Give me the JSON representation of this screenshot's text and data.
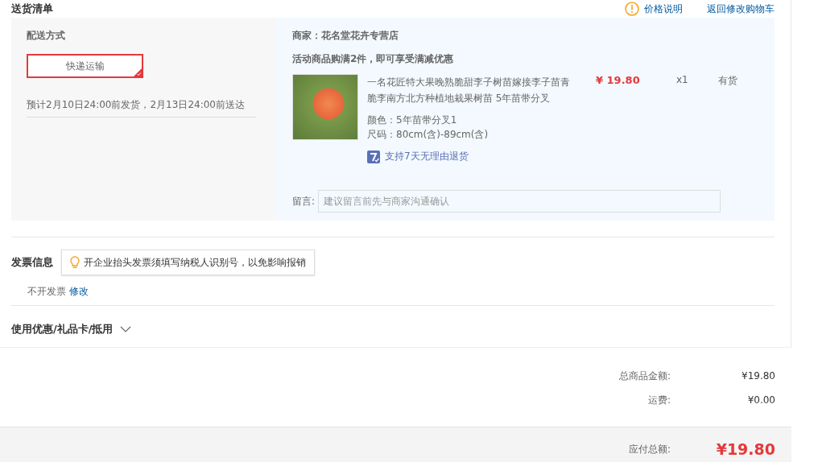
{
  "header": {
    "title": "送货清单",
    "links": [
      {
        "kind": "info",
        "label": "价格说明"
      },
      {
        "kind": "plain",
        "label": "返回修改购物车"
      }
    ]
  },
  "shipping": {
    "heading": "配送方式",
    "options": [
      {
        "label": "快递运输",
        "selected": true
      }
    ],
    "estimate": "预计2月10日24:00前发货，2月13日24:00前送达"
  },
  "merchant": {
    "name": "商家：花名堂花卉专营店",
    "promo": "活动商品购满2件，即可享受满减优惠",
    "item": {
      "title": "一名花匠特大果晚熟脆甜李子树苗嫁接李子苗青脆李南方北方种植地栽果树苗 5年苗带分叉",
      "price": "¥ 19.80",
      "qty": "x1",
      "stock": "有货",
      "attrs": [
        "颜色：5年苗带分叉1",
        "尺码：80cm(含)-89cm(含)"
      ],
      "return_policy": "支持7天无理由退货"
    },
    "note": {
      "label": "留言:",
      "placeholder": "建议留言前先与商家沟通确认"
    }
  },
  "invoice": {
    "heading": "发票信息",
    "tip": "开企业抬头发票须填写纳税人识别号，以免影响报销",
    "value": "不开发票",
    "edit": "修改"
  },
  "coupons": {
    "label": "使用优惠/礼品卡/抵用",
    "expanded": false
  },
  "summary": [
    {
      "label": "总商品金额:",
      "value": "¥19.80"
    },
    {
      "label": "运费:",
      "value": "¥0.00"
    }
  ],
  "total": {
    "label": "应付总额:",
    "value": "¥19.80"
  }
}
